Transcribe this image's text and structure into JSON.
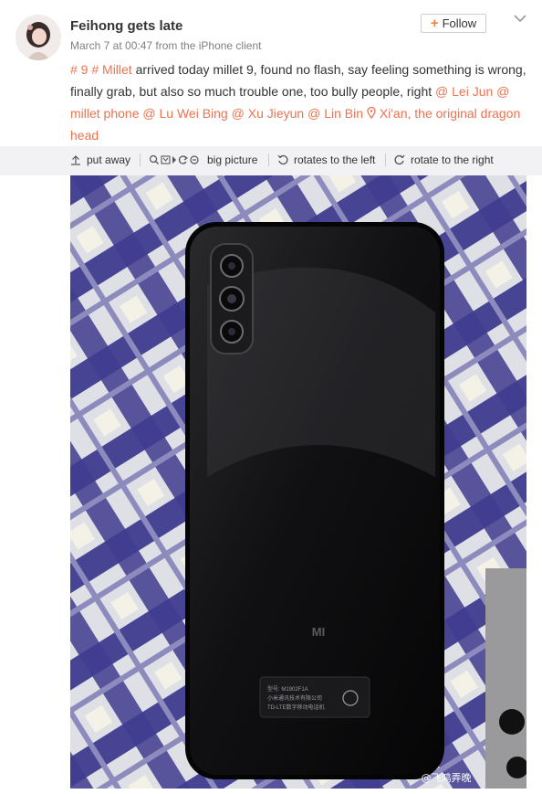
{
  "post": {
    "username": "Feihong gets late",
    "meta": "March 7 at 00:47 from the iPhone client",
    "follow_label": "Follow",
    "text": {
      "tag1": "# 9 # Millet",
      "body": " arrived today millet 9, found no flash, say feeling something is wrong, finally grab, but also so much trouble one, too bully people, right ",
      "mention1": "@ Lei Jun",
      "mention2": "@ millet phone",
      "mention3": "@ Lu Wei Bing",
      "mention4": "@ Xu Jieyun",
      "mention5": "@ Lin Bin",
      "location": "Xi'an, the original dragon head"
    }
  },
  "toolbar": {
    "put_away": "put away",
    "big_picture": "big picture",
    "rotate_left": "rotates to the left",
    "rotate_right": "rotate to the right"
  },
  "photo": {
    "phone_brand": "MI",
    "label_line1": "型号: M1902F1A",
    "label_line2": "小米通讯技术有限公司",
    "label_line3": "TD-LTE数字移动电话机",
    "watermark": "@飞鸿弄晚"
  },
  "colors": {
    "accent": "#eb7350",
    "follow_plus": "#ff8140",
    "toolbar_bg": "#f2f2f5"
  }
}
